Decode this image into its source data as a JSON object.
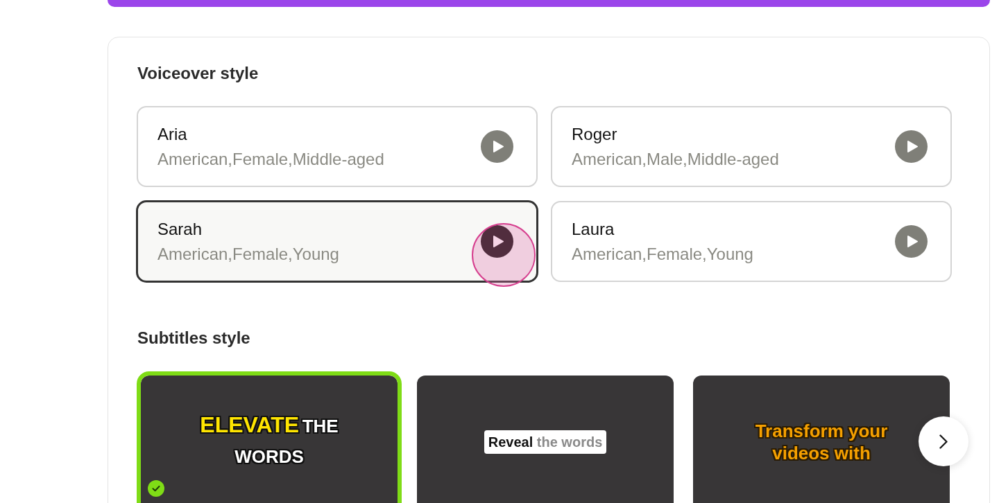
{
  "voiceover": {
    "title": "Voiceover style",
    "voices": [
      {
        "name": "Aria",
        "description": "American,Female,Middle-aged",
        "selected": false,
        "click_marker": false
      },
      {
        "name": "Roger",
        "description": "American,Male,Middle-aged",
        "selected": false,
        "click_marker": false
      },
      {
        "name": "Sarah",
        "description": "American,Female,Young",
        "selected": true,
        "click_marker": true
      },
      {
        "name": "Laura",
        "description": "American,Female,Young",
        "selected": false,
        "click_marker": false
      }
    ]
  },
  "subtitles": {
    "title": "Subtitles style",
    "styles": [
      {
        "kind": "pop",
        "selected": true,
        "caption": [
          {
            "text": "ELEVATE",
            "highlighted": true
          },
          {
            "text": "THE WORDS",
            "highlighted": false
          }
        ]
      },
      {
        "kind": "boxed",
        "selected": false,
        "caption": [
          {
            "text": "Reveal",
            "highlighted": true
          },
          {
            "text": "the words",
            "highlighted": false
          }
        ]
      },
      {
        "kind": "outline",
        "selected": false,
        "caption": [
          {
            "text": "Transform your videos with",
            "highlighted": false
          }
        ]
      }
    ]
  }
}
